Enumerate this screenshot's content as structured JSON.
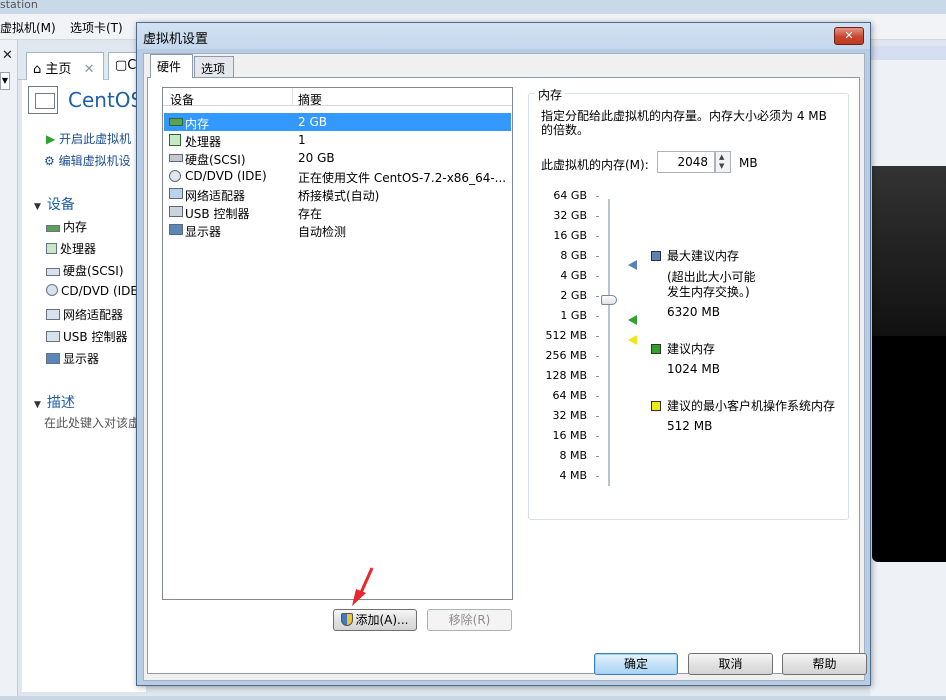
{
  "bg": {
    "window_title": "station",
    "menu": [
      "虚拟机(M)",
      "选项卡(T)"
    ],
    "tabs": [
      {
        "label": "主页",
        "close": "✕"
      },
      {
        "label": "C"
      }
    ],
    "vm_name": "CentOS",
    "actions": [
      "开启此虚拟机",
      "编辑虚拟机设"
    ],
    "devices_section": "设备",
    "devices": [
      "内存",
      "处理器",
      "硬盘(SCSI)",
      "CD/DVD (IDE",
      "网络适配器",
      "USB 控制器",
      "显示器"
    ],
    "desc_section": "描述",
    "desc_placeholder": "在此处键入对该虚",
    "close_x": "✕"
  },
  "dialog": {
    "title": "虚拟机设置",
    "close": "✕",
    "tabs": [
      "硬件",
      "选项"
    ],
    "table_headers": {
      "device": "设备",
      "summary": "摘要"
    },
    "rows": [
      {
        "icon": "memory-icon",
        "device": "内存",
        "summary": "2 GB",
        "selected": true
      },
      {
        "icon": "processor-icon",
        "device": "处理器",
        "summary": "1"
      },
      {
        "icon": "hard-disk-icon",
        "device": "硬盘(SCSI)",
        "summary": "20 GB"
      },
      {
        "icon": "cd-dvd-icon",
        "device": "CD/DVD (IDE)",
        "summary": "正在使用文件 CentOS-7.2-x86_64-..."
      },
      {
        "icon": "network-adapter-icon",
        "device": "网络适配器",
        "summary": "桥接模式(自动)"
      },
      {
        "icon": "usb-icon",
        "device": "USB 控制器",
        "summary": "存在"
      },
      {
        "icon": "display-icon",
        "device": "显示器",
        "summary": "自动检测"
      }
    ],
    "add_button": "添加(A)...",
    "remove_button": "移除(R)",
    "memory": {
      "group_title": "内存",
      "description": "指定分配给此虚拟机的内存量。内存大小必须为 4 MB 的倍数。",
      "label": "此虚拟机的内存(M):",
      "value": "2048",
      "unit": "MB",
      "scale": [
        "64 GB",
        "32 GB",
        "16 GB",
        "8 GB",
        "4 GB",
        "2 GB",
        "1 GB",
        "512 MB",
        "256 MB",
        "128 MB",
        "64 MB",
        "32 MB",
        "16 MB",
        "8 MB",
        "4 MB"
      ],
      "slider_value": "2 GB",
      "legend": [
        {
          "color": "#5b82b6",
          "title": "最大建议内存",
          "note_line1": "(超出此大小可能",
          "note_line2": "发生内存交换。)",
          "value": "6320 MB"
        },
        {
          "color": "#33a02c",
          "title": "建议内存",
          "value": "1024 MB"
        },
        {
          "color": "#f2e51a",
          "title": "建议的最小客户机操作系统内存",
          "value": "512 MB"
        }
      ]
    },
    "ok": "确定",
    "cancel": "取消",
    "help": "帮助"
  },
  "colors": {
    "selection": "#3399ff",
    "annotation_arrow": "#e8262b"
  }
}
